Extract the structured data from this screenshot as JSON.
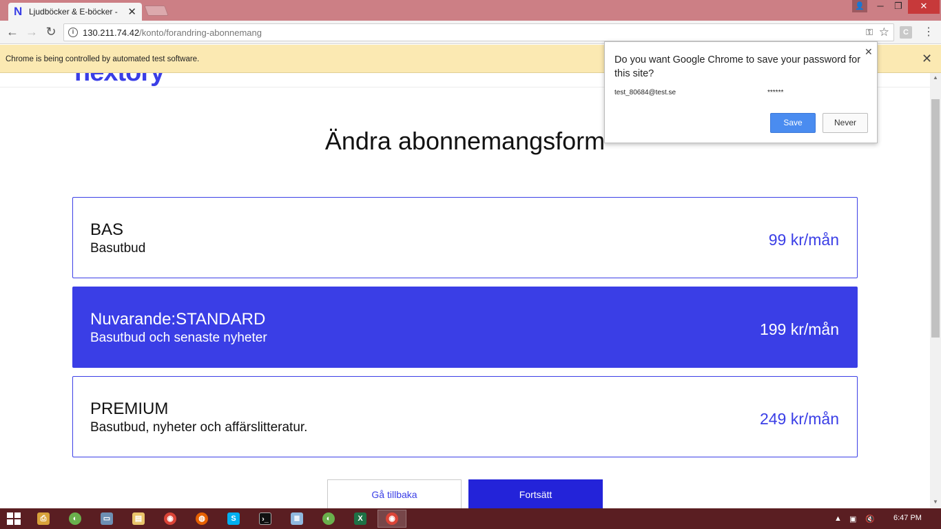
{
  "browser": {
    "tab_title": "Ljudböcker & E-böcker -",
    "tab_favicon": "N",
    "url_host": "130.211.74.42",
    "url_path": "/konto/forandring-abonnemang",
    "extension_letter": "C"
  },
  "infobar": {
    "text": "Chrome is being controlled by automated test software."
  },
  "page": {
    "logo": "nextory",
    "title": "Ändra abonnemangsform",
    "plans": [
      {
        "name": "BAS",
        "description": "Basutbud",
        "price": "99 kr/mån",
        "selected": false
      },
      {
        "name": "Nuvarande:STANDARD",
        "description": "Basutbud och senaste nyheter",
        "price": "199 kr/mån",
        "selected": true
      },
      {
        "name": "PREMIUM",
        "description": "Basutbud, nyheter och affärslitteratur.",
        "price": "249 kr/mån",
        "selected": false
      }
    ],
    "back_button": "Gå tillbaka",
    "continue_button": "Fortsätt"
  },
  "password_bubble": {
    "title": "Do you want Google Chrome to save your password for this site?",
    "username": "test_80684@test.se",
    "password": "******",
    "save_label": "Save",
    "never_label": "Never"
  },
  "taskbar": {
    "clock": "6:47 PM"
  },
  "colors": {
    "brand": "#3a3ee6",
    "continue_button": "#2323d9",
    "infobar": "#fbe9b2",
    "titlebar": "#cc7f85",
    "taskbar": "#5a1e22"
  }
}
